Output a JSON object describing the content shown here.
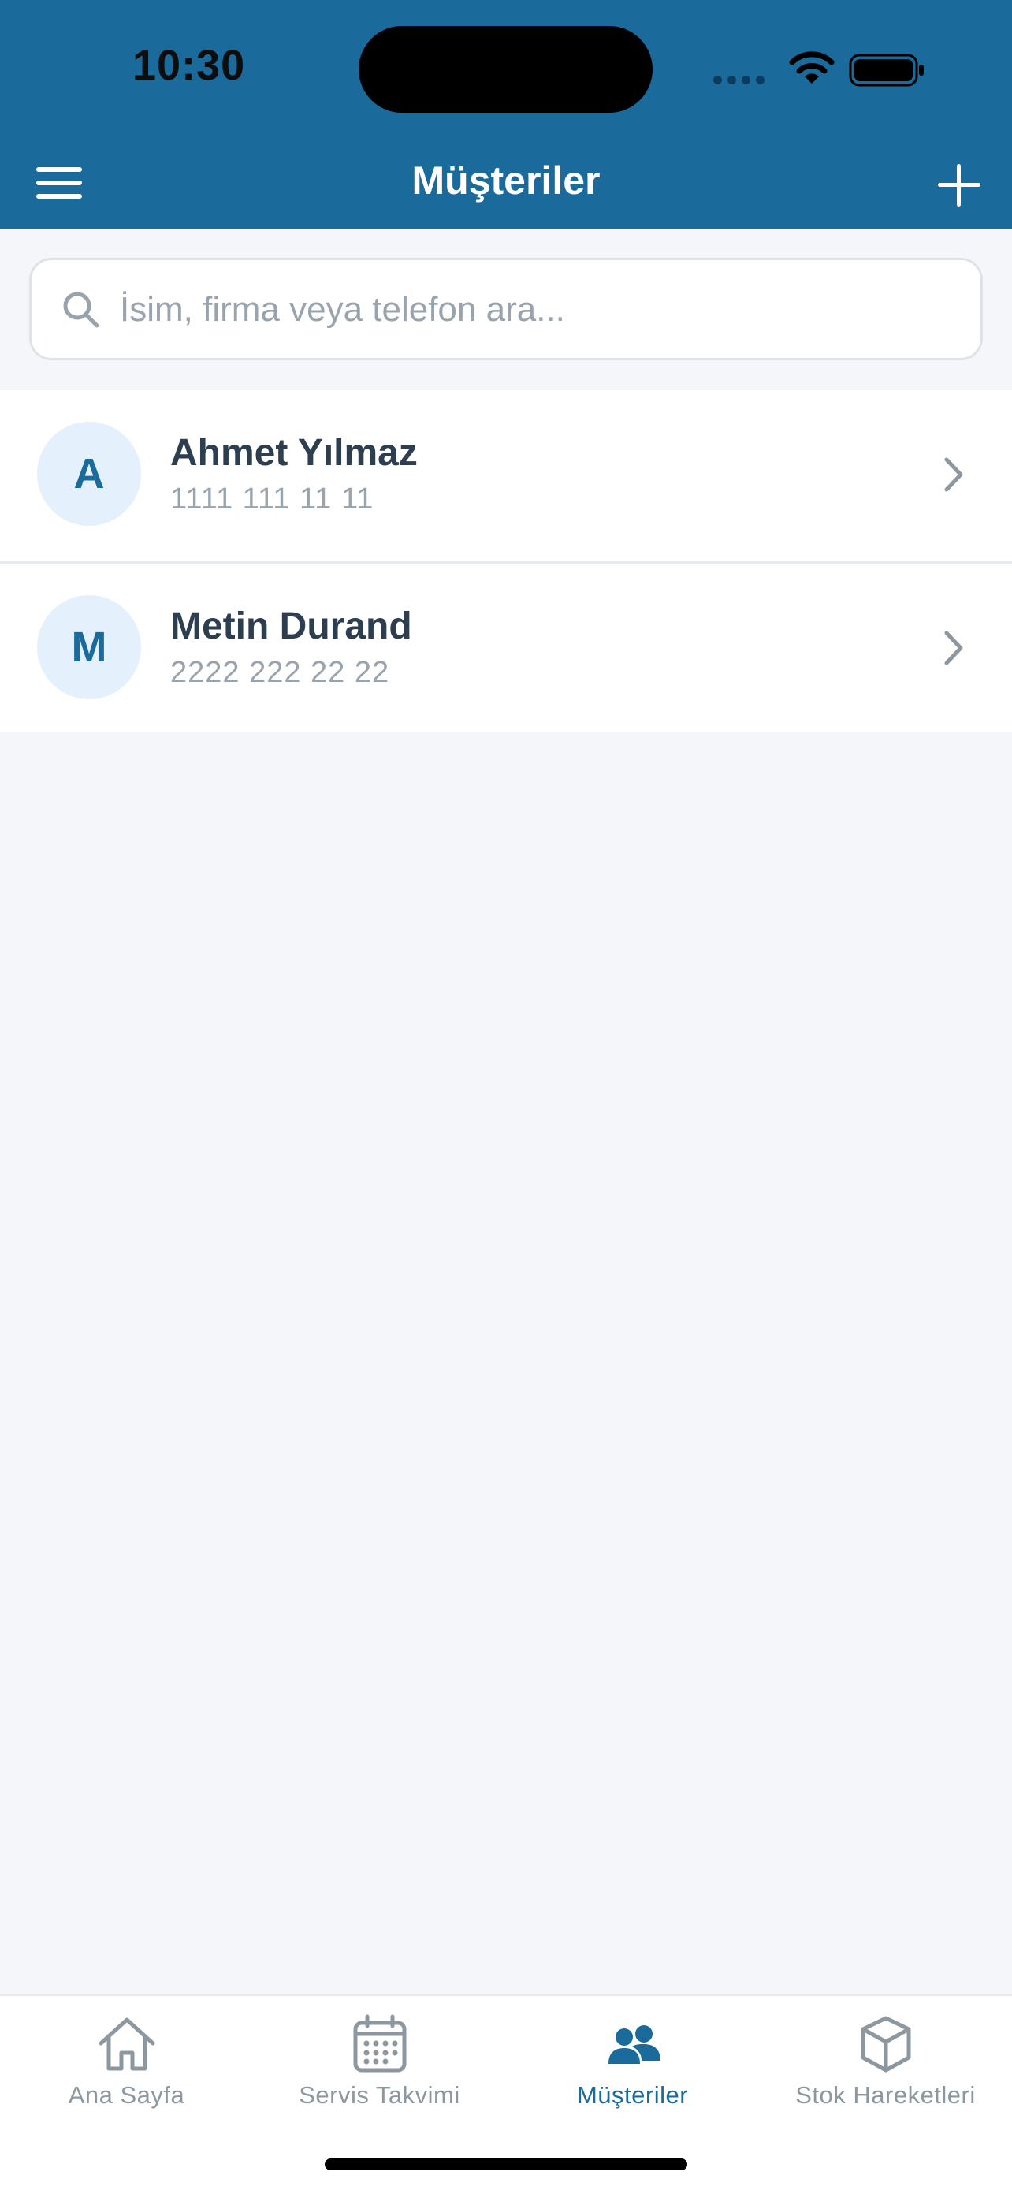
{
  "status_bar": {
    "time": "10:30"
  },
  "header": {
    "title": "Müşteriler"
  },
  "search": {
    "placeholder": "İsim, firma veya telefon ara..."
  },
  "customers": [
    {
      "initial": "A",
      "name": "Ahmet Yılmaz",
      "phone": "1111 111 11 11"
    },
    {
      "initial": "M",
      "name": "Metin Durand",
      "phone": "2222 222 22 22"
    }
  ],
  "tabs": [
    {
      "label": "Ana Sayfa",
      "icon": "home-icon",
      "active": false
    },
    {
      "label": "Servis Takvimi",
      "icon": "calendar-icon",
      "active": false
    },
    {
      "label": "Müşteriler",
      "icon": "users-icon",
      "active": true
    },
    {
      "label": "Stok Hareketleri",
      "icon": "box-icon",
      "active": false
    }
  ],
  "colors": {
    "primary": "#1b6a9c",
    "background": "#f4f6fa",
    "text": "#2c3e50",
    "muted": "#99a3ad",
    "avatar_bg": "#e4f0fb"
  }
}
